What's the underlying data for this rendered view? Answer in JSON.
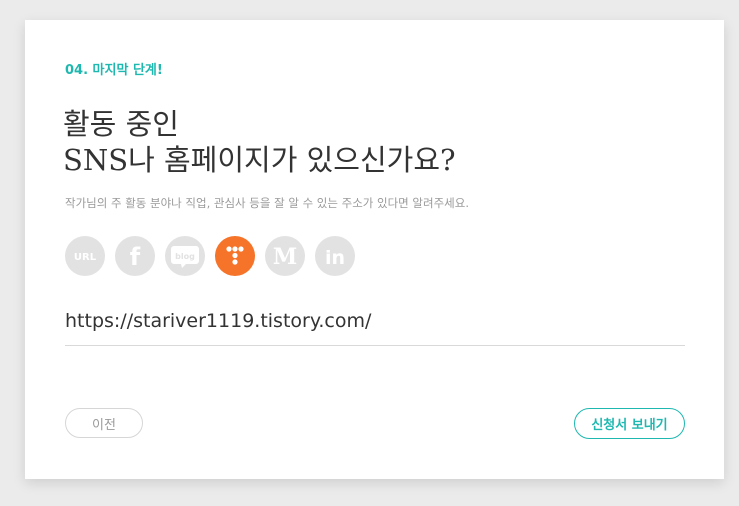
{
  "step": {
    "label": "04. 마지막 단계!"
  },
  "heading": {
    "line1": "활동 중인",
    "line2": "SNS나 홈페이지가 있으신가요?"
  },
  "description": "작가님의 주 활동 분야나 직업, 관심사 등을 잘 알 수 있는 주소가 있다면 알려주세요.",
  "sns_icons": [
    {
      "name": "url",
      "label": "URL",
      "icon": "url-icon",
      "selected": false
    },
    {
      "name": "facebook",
      "label": "f",
      "icon": "facebook-icon",
      "selected": false
    },
    {
      "name": "blog",
      "label": "blog",
      "icon": "blog-icon",
      "selected": false
    },
    {
      "name": "tistory",
      "label": "",
      "icon": "tistory-icon",
      "selected": true
    },
    {
      "name": "medium",
      "label": "M",
      "icon": "medium-icon",
      "selected": false
    },
    {
      "name": "linkedin",
      "label": "in",
      "icon": "linkedin-icon",
      "selected": false
    }
  ],
  "url_field": {
    "value": "https://stariver1119.tistory.com/"
  },
  "buttons": {
    "prev": "이전",
    "submit": "신청서 보내기"
  },
  "colors": {
    "accent": "#1fb8b0",
    "selected_icon": "#f5742a",
    "icon_inactive": "#e2e2e2"
  }
}
